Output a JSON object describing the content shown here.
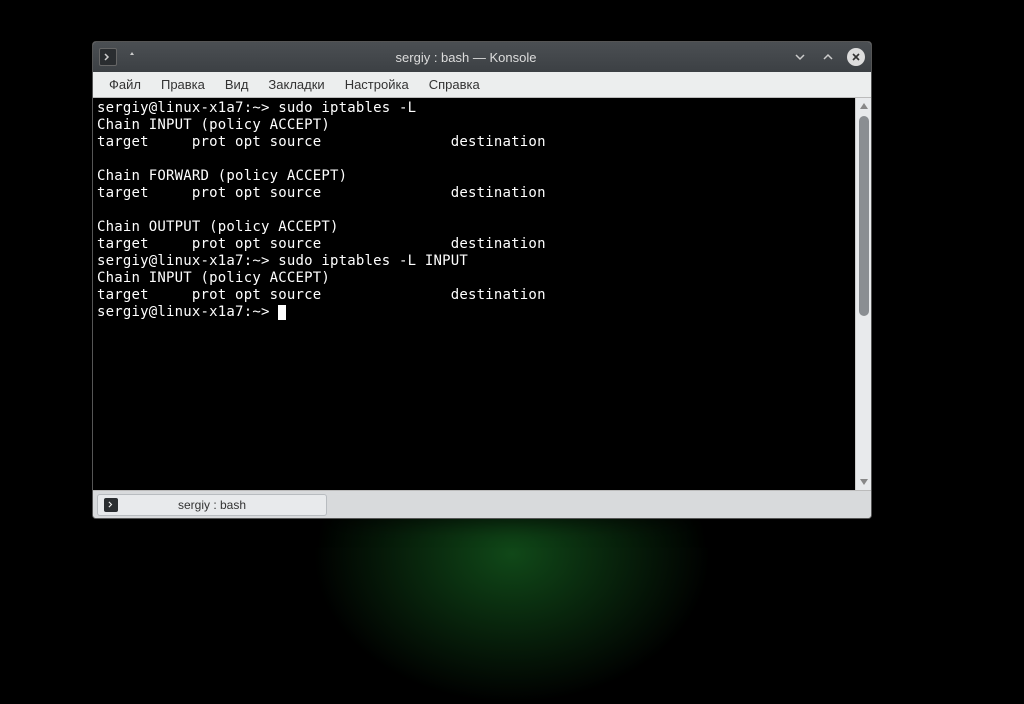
{
  "window": {
    "title": "sergiy : bash — Konsole"
  },
  "menu": {
    "file": "Файл",
    "edit": "Правка",
    "view": "Вид",
    "bookmarks": "Закладки",
    "settings": "Настройка",
    "help": "Справка"
  },
  "terminal": {
    "lines": [
      "sergiy@linux-x1a7:~> sudo iptables -L",
      "Chain INPUT (policy ACCEPT)",
      "target     prot opt source               destination",
      "",
      "Chain FORWARD (policy ACCEPT)",
      "target     prot opt source               destination",
      "",
      "Chain OUTPUT (policy ACCEPT)",
      "target     prot opt source               destination",
      "sergiy@linux-x1a7:~> sudo iptables -L INPUT",
      "Chain INPUT (policy ACCEPT)",
      "target     prot opt source               destination",
      "sergiy@linux-x1a7:~> "
    ]
  },
  "tab": {
    "label": "sergiy : bash"
  }
}
